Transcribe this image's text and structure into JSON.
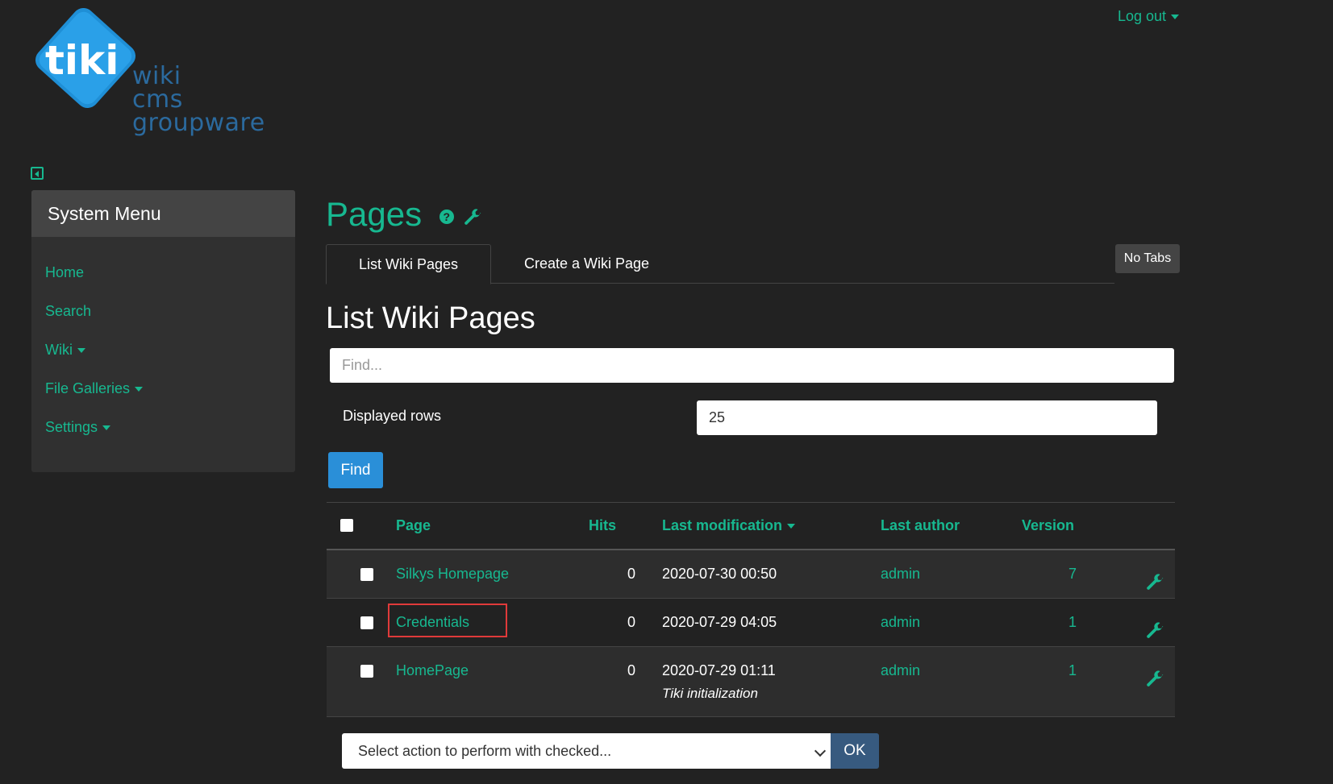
{
  "header": {
    "logo_text": "tiki",
    "logo_words": [
      "wiki",
      "cms",
      "groupware"
    ],
    "logout_label": "Log out"
  },
  "sidebar": {
    "title": "System Menu",
    "items": [
      {
        "label": "Home",
        "has_caret": false
      },
      {
        "label": "Search",
        "has_caret": false
      },
      {
        "label": "Wiki",
        "has_caret": true
      },
      {
        "label": "File Galleries",
        "has_caret": true
      },
      {
        "label": "Settings",
        "has_caret": true
      }
    ]
  },
  "main": {
    "page_title": "Pages",
    "help_icon": "question-circle-icon",
    "admin_icon": "wrench-icon",
    "tabs": [
      {
        "label": "List Wiki Pages",
        "active": true
      },
      {
        "label": "Create a Wiki Page",
        "active": false
      }
    ],
    "no_tabs_label": "No Tabs",
    "section_title": "List Wiki Pages",
    "find_placeholder": "Find...",
    "displayed_rows_label": "Displayed rows",
    "displayed_rows_value": "25",
    "find_button": "Find"
  },
  "table": {
    "columns": [
      "Page",
      "Hits",
      "Last modification",
      "Last author",
      "Version"
    ],
    "sorted_column": "Last modification",
    "rows": [
      {
        "page": "Silkys Homepage",
        "hits": "0",
        "modified": "2020-07-30 00:50",
        "note": "",
        "author": "admin",
        "version": "7",
        "highlighted": false
      },
      {
        "page": "Credentials",
        "hits": "0",
        "modified": "2020-07-29 04:05",
        "note": "",
        "author": "admin",
        "version": "1",
        "highlighted": true
      },
      {
        "page": "HomePage",
        "hits": "0",
        "modified": "2020-07-29 01:11",
        "note": "Tiki initialization",
        "author": "admin",
        "version": "1",
        "highlighted": false
      }
    ]
  },
  "footer": {
    "action_placeholder": "Select action to perform with checked...",
    "ok_button": "OK"
  },
  "colors": {
    "accent": "#17b890",
    "background": "#222222",
    "primary_button": "#2a8fd8",
    "highlight": "#e03a3a"
  }
}
